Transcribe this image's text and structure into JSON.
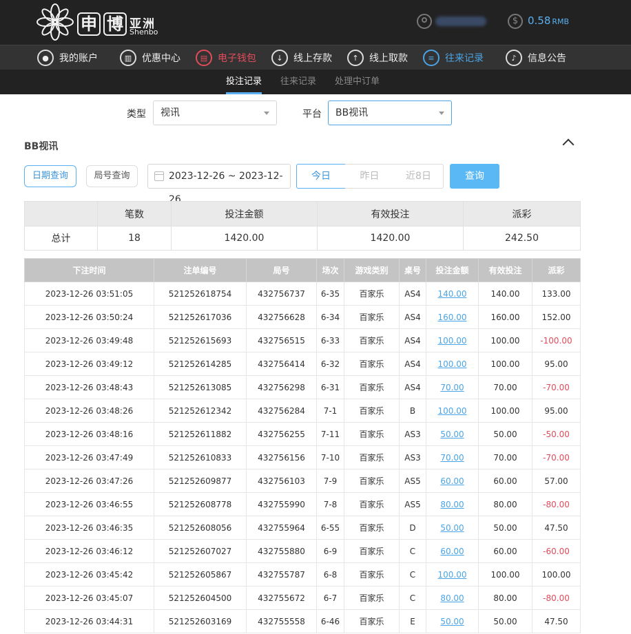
{
  "header": {
    "logo_cn": "亚洲",
    "logo_en": "Shenbo",
    "logo_char1": "申",
    "logo_char2": "博",
    "balance": "0.58",
    "currency": "RMB"
  },
  "nav": [
    {
      "label": "我的账户",
      "icon": "user-icon"
    },
    {
      "label": "优惠中心",
      "icon": "gift-icon"
    },
    {
      "label": "电子钱包",
      "icon": "wallet-icon"
    },
    {
      "label": "线上存款",
      "icon": "deposit-icon"
    },
    {
      "label": "线上取款",
      "icon": "withdraw-icon"
    },
    {
      "label": "往来记录",
      "icon": "record-icon"
    },
    {
      "label": "信息公告",
      "icon": "bell-icon"
    }
  ],
  "subtabs": [
    "投注记录",
    "往来记录",
    "处理中订单"
  ],
  "filters": {
    "type_label": "类型",
    "type_value": "视讯",
    "platform_label": "平台",
    "platform_value": "BB视讯"
  },
  "section_title": "BB视讯",
  "query": {
    "date_query": "日期查询",
    "round_query": "局号查询",
    "date_range": "2023-12-26 ~ 2023-12-26",
    "today": "今日",
    "yesterday": "昨日",
    "last8": "近8日",
    "submit": "查询"
  },
  "summary": {
    "headers": [
      "",
      "笔数",
      "投注金额",
      "有效投注",
      "派彩"
    ],
    "row": [
      "总计",
      "18",
      "1420.00",
      "1420.00",
      "242.50"
    ]
  },
  "records": {
    "headers": [
      "下注时间",
      "注单编号",
      "局号",
      "场次",
      "游戏类别",
      "桌号",
      "投注金额",
      "有效投注",
      "派彩"
    ],
    "rows": [
      [
        "2023-12-26 03:51:05",
        "521252618754",
        "432756737",
        "6-35",
        "百家乐",
        "AS4",
        "140.00",
        "140.00",
        "133.00"
      ],
      [
        "2023-12-26 03:50:24",
        "521252617036",
        "432756628",
        "6-34",
        "百家乐",
        "AS4",
        "160.00",
        "160.00",
        "152.00"
      ],
      [
        "2023-12-26 03:49:48",
        "521252615693",
        "432756515",
        "6-33",
        "百家乐",
        "AS4",
        "100.00",
        "100.00",
        "-100.00"
      ],
      [
        "2023-12-26 03:49:12",
        "521252614285",
        "432756414",
        "6-32",
        "百家乐",
        "AS4",
        "100.00",
        "100.00",
        "95.00"
      ],
      [
        "2023-12-26 03:48:43",
        "521252613085",
        "432756298",
        "6-31",
        "百家乐",
        "AS4",
        "70.00",
        "70.00",
        "-70.00"
      ],
      [
        "2023-12-26 03:48:26",
        "521252612342",
        "432756284",
        "7-1",
        "百家乐",
        "B",
        "100.00",
        "100.00",
        "95.00"
      ],
      [
        "2023-12-26 03:48:16",
        "521252611882",
        "432756255",
        "7-11",
        "百家乐",
        "AS3",
        "50.00",
        "50.00",
        "-50.00"
      ],
      [
        "2023-12-26 03:47:49",
        "521252610833",
        "432756156",
        "7-10",
        "百家乐",
        "AS3",
        "70.00",
        "70.00",
        "-70.00"
      ],
      [
        "2023-12-26 03:47:26",
        "521252609877",
        "432756103",
        "7-9",
        "百家乐",
        "AS5",
        "60.00",
        "60.00",
        "57.00"
      ],
      [
        "2023-12-26 03:46:55",
        "521252608778",
        "432755990",
        "7-8",
        "百家乐",
        "AS5",
        "80.00",
        "80.00",
        "-80.00"
      ],
      [
        "2023-12-26 03:46:35",
        "521252608056",
        "432755964",
        "6-55",
        "百家乐",
        "D",
        "50.00",
        "50.00",
        "47.50"
      ],
      [
        "2023-12-26 03:46:12",
        "521252607027",
        "432755880",
        "6-9",
        "百家乐",
        "C",
        "60.00",
        "60.00",
        "-60.00"
      ],
      [
        "2023-12-26 03:45:42",
        "521252605867",
        "432755787",
        "6-8",
        "百家乐",
        "C",
        "100.00",
        "100.00",
        "100.00"
      ],
      [
        "2023-12-26 03:45:07",
        "521252604500",
        "432755672",
        "6-7",
        "百家乐",
        "C",
        "80.00",
        "80.00",
        "-80.00"
      ],
      [
        "2023-12-26 03:44:31",
        "521252603169",
        "432755558",
        "6-46",
        "百家乐",
        "E",
        "50.00",
        "50.00",
        "47.50"
      ]
    ]
  },
  "colors": {
    "accent_blue": "#4aa4e6",
    "negative_red": "#e34b5b",
    "header_bg": "#222222"
  }
}
